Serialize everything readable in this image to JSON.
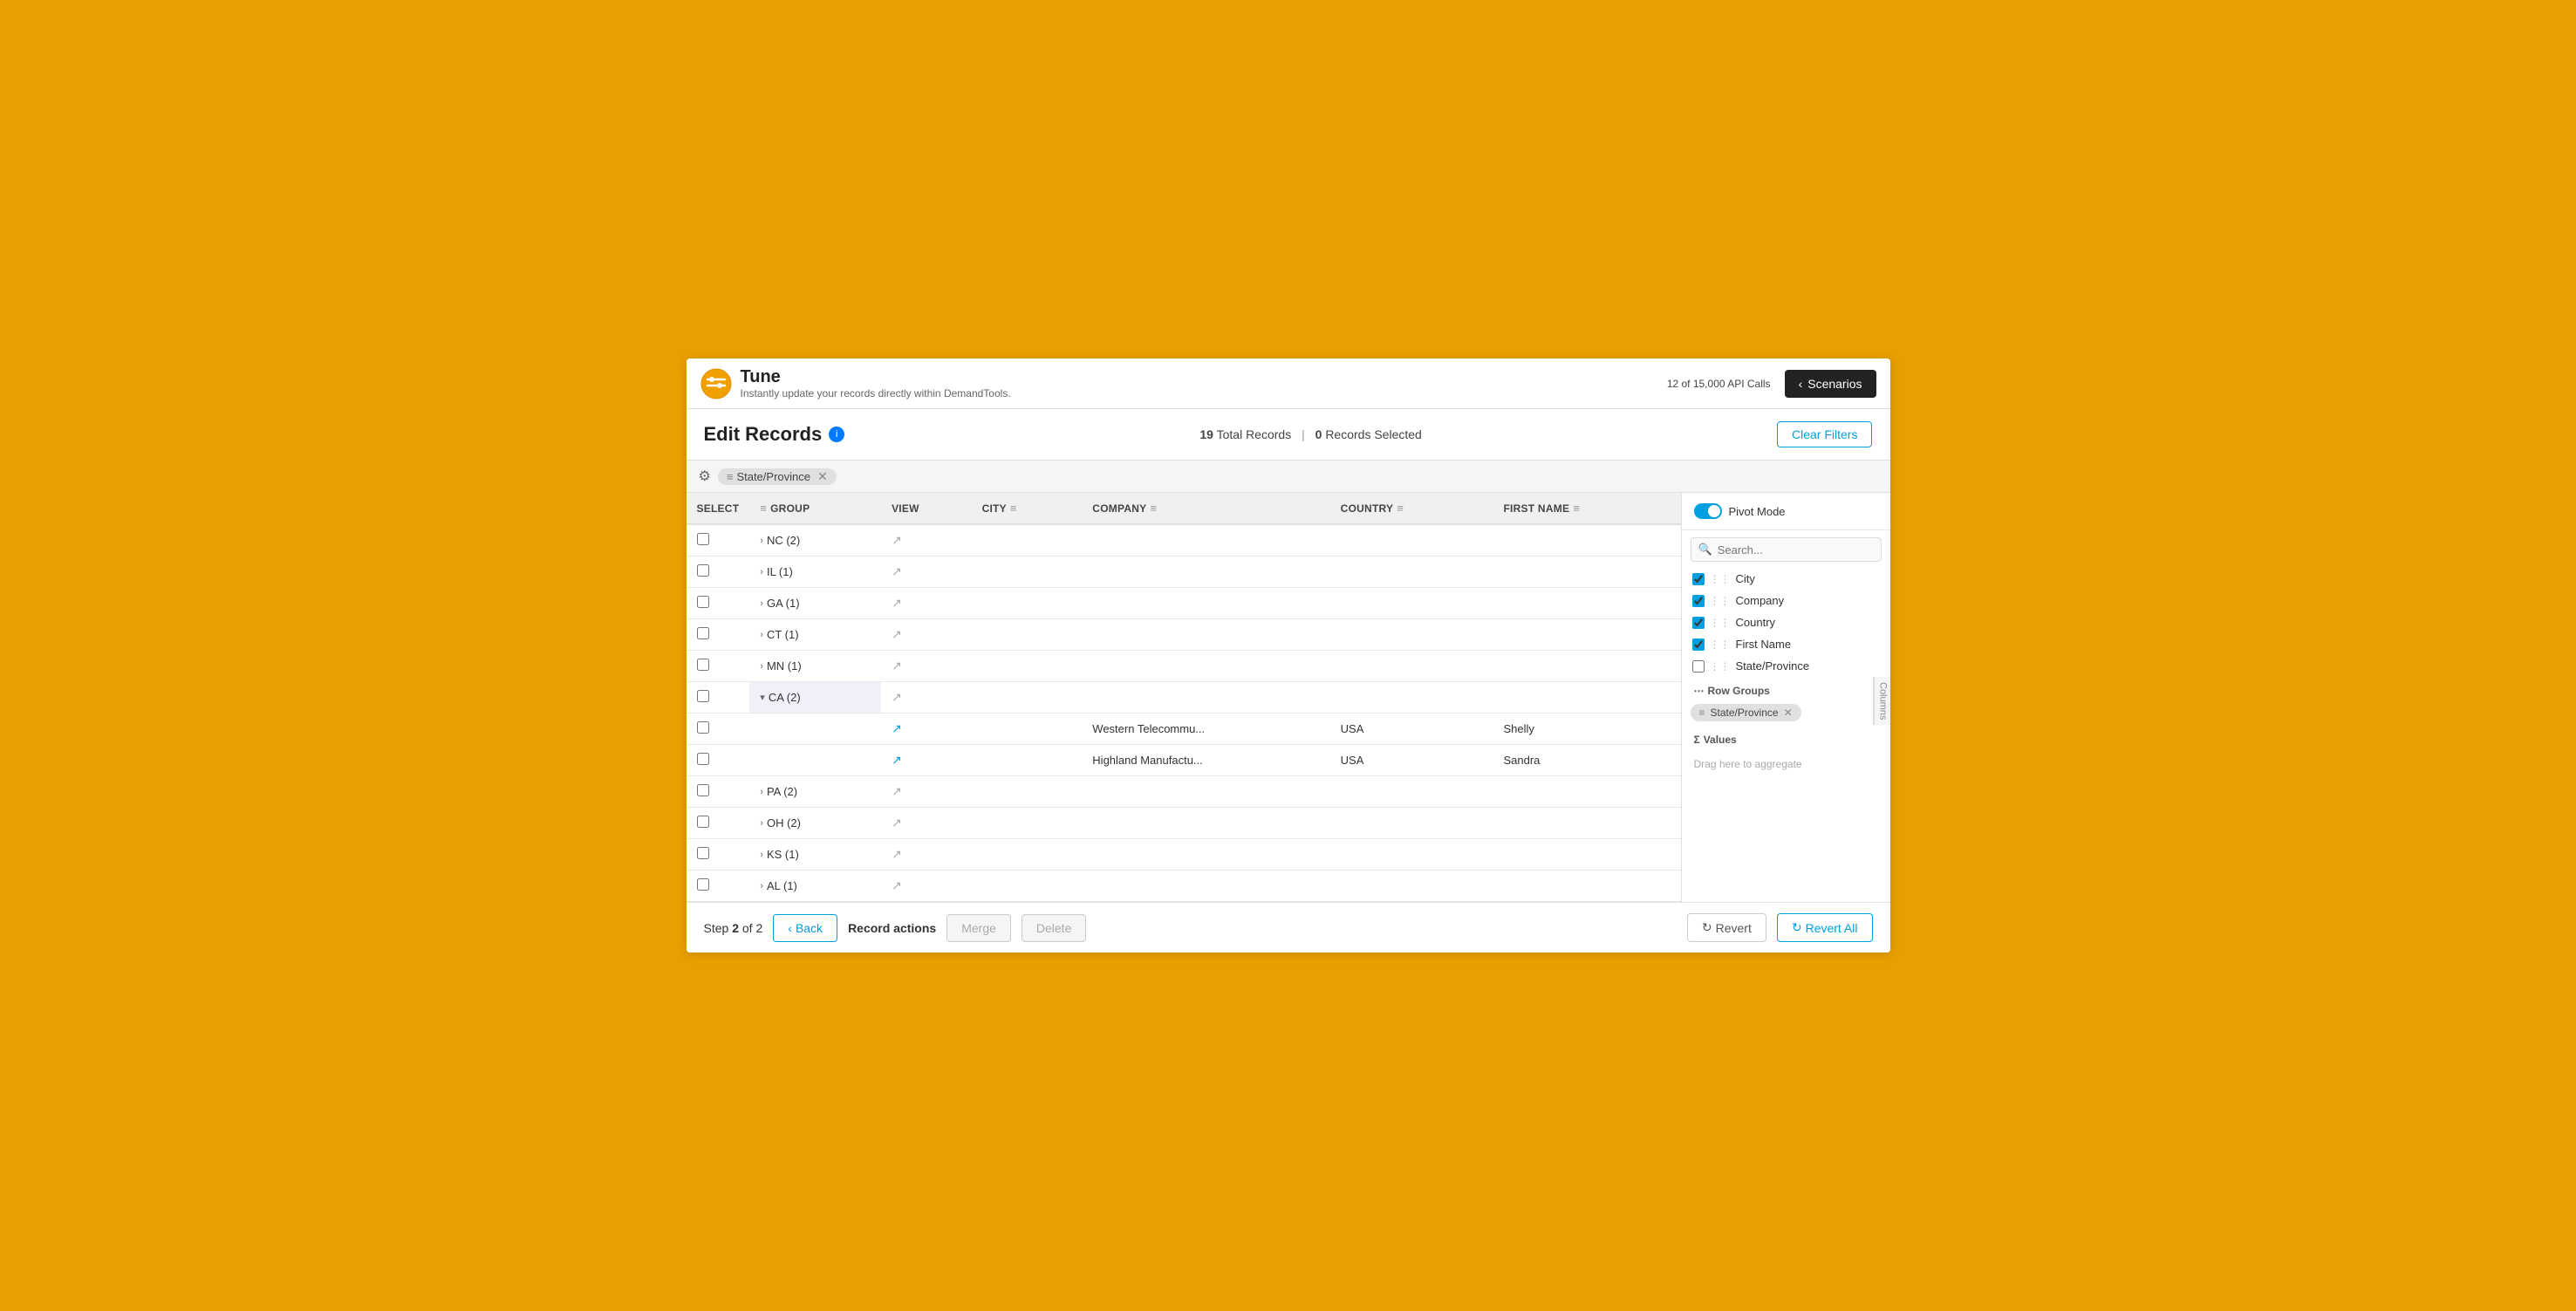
{
  "app": {
    "logo_title": "Tune",
    "logo_subtitle": "Instantly update your records directly within DemandTools.",
    "api_calls_label": "12 of 15,000 API Calls",
    "scenarios_button": "Scenarios"
  },
  "header": {
    "page_title": "Edit Records",
    "total_records": "19",
    "records_selected": "0",
    "total_label": "Total Records",
    "selected_label": "Records Selected",
    "clear_filters_button": "Clear Filters"
  },
  "filter": {
    "active_filter": "State/Province"
  },
  "table": {
    "columns": [
      {
        "key": "select",
        "label": "SELECT"
      },
      {
        "key": "group",
        "label": "GROUP"
      },
      {
        "key": "view",
        "label": "VIEW"
      },
      {
        "key": "city",
        "label": "CITY"
      },
      {
        "key": "company",
        "label": "COMPANY"
      },
      {
        "key": "country",
        "label": "COUNTRY"
      },
      {
        "key": "first_name",
        "label": "FIRST NAME"
      }
    ],
    "rows": [
      {
        "id": 1,
        "group": "NC (2)",
        "view_type": "gray",
        "city": "",
        "company": "",
        "country": "",
        "first_name": "",
        "expanded": false
      },
      {
        "id": 2,
        "group": "IL (1)",
        "view_type": "gray",
        "city": "",
        "company": "",
        "country": "",
        "first_name": "",
        "expanded": false
      },
      {
        "id": 3,
        "group": "GA (1)",
        "view_type": "gray",
        "city": "",
        "company": "",
        "country": "",
        "first_name": "",
        "expanded": false
      },
      {
        "id": 4,
        "group": "CT (1)",
        "view_type": "gray",
        "city": "",
        "company": "",
        "country": "",
        "first_name": "",
        "expanded": false
      },
      {
        "id": 5,
        "group": "MN (1)",
        "view_type": "gray",
        "city": "",
        "company": "",
        "country": "",
        "first_name": "",
        "expanded": false
      },
      {
        "id": 6,
        "group": "CA (2)",
        "view_type": "gray",
        "city": "",
        "company": "",
        "country": "",
        "first_name": "",
        "expanded": true,
        "is_group_header": true
      },
      {
        "id": 7,
        "group": "",
        "view_type": "blue",
        "city": "",
        "company": "Western Telecommu...",
        "country": "USA",
        "first_name": "Shelly",
        "expanded": false
      },
      {
        "id": 8,
        "group": "",
        "view_type": "blue",
        "city": "",
        "company": "Highland Manufactu...",
        "country": "USA",
        "first_name": "Sandra",
        "expanded": false
      },
      {
        "id": 9,
        "group": "PA (2)",
        "view_type": "gray",
        "city": "",
        "company": "",
        "country": "",
        "first_name": "",
        "expanded": false
      },
      {
        "id": 10,
        "group": "OH (2)",
        "view_type": "gray",
        "city": "",
        "company": "",
        "country": "",
        "first_name": "",
        "expanded": false
      },
      {
        "id": 11,
        "group": "KS (1)",
        "view_type": "gray",
        "city": "",
        "company": "",
        "country": "",
        "first_name": "",
        "expanded": false
      },
      {
        "id": 12,
        "group": "AL (1)",
        "view_type": "gray",
        "city": "",
        "company": "",
        "country": "",
        "first_name": "",
        "expanded": false
      }
    ]
  },
  "right_panel": {
    "pivot_mode_label": "Pivot Mode",
    "search_placeholder": "Search...",
    "columns_sidebar_label": "Columns",
    "columns": [
      {
        "name": "City",
        "checked": true
      },
      {
        "name": "Company",
        "checked": true
      },
      {
        "name": "Country",
        "checked": true
      },
      {
        "name": "First Name",
        "checked": true
      },
      {
        "name": "State/Province",
        "checked": false
      }
    ],
    "row_groups_label": "Row Groups",
    "row_group_tag": "State/Province",
    "values_label": "Values",
    "drag_placeholder": "Drag here to aggregate"
  },
  "bottom_bar": {
    "step_label": "Step",
    "step_current": "2",
    "step_total": "2",
    "back_button": "Back",
    "record_actions_label": "Record actions",
    "merge_button": "Merge",
    "delete_button": "Delete",
    "revert_button": "Revert",
    "revert_all_button": "Revert All"
  }
}
